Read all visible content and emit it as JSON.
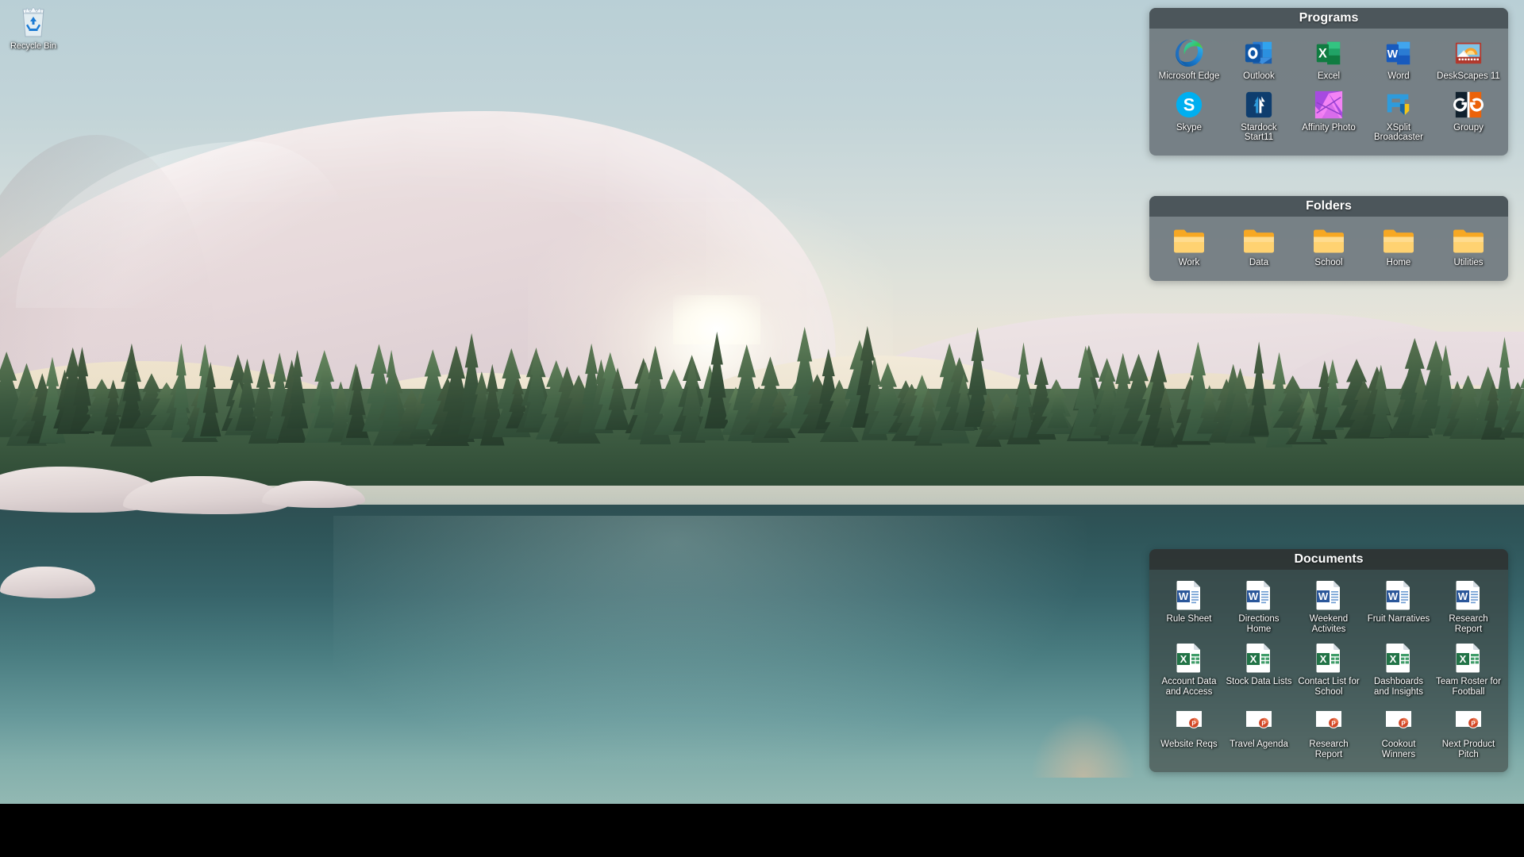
{
  "desktop": {
    "icons": [
      {
        "label": "Recycle Bin",
        "icon": "recycle-bin-icon"
      }
    ]
  },
  "fences": [
    {
      "id": "programs",
      "title": "Programs",
      "items": [
        {
          "label": "Microsoft Edge",
          "icon": "microsoft-edge-icon"
        },
        {
          "label": "Outlook",
          "icon": "outlook-icon"
        },
        {
          "label": "Excel",
          "icon": "excel-icon"
        },
        {
          "label": "Word",
          "icon": "word-icon"
        },
        {
          "label": "DeskScapes 11",
          "icon": "deskscapes-icon"
        },
        {
          "label": "Skype",
          "icon": "skype-icon"
        },
        {
          "label": "Stardock Start11",
          "icon": "start11-icon"
        },
        {
          "label": "Affinity Photo",
          "icon": "affinity-photo-icon"
        },
        {
          "label": "XSplit Broadcaster",
          "icon": "xsplit-broadcaster-icon"
        },
        {
          "label": "Groupy",
          "icon": "groupy-icon"
        }
      ]
    },
    {
      "id": "folders",
      "title": "Folders",
      "items": [
        {
          "label": "Work",
          "icon": "folder-icon"
        },
        {
          "label": "Data",
          "icon": "folder-icon"
        },
        {
          "label": "School",
          "icon": "folder-icon"
        },
        {
          "label": "Home",
          "icon": "folder-icon"
        },
        {
          "label": "Utilities",
          "icon": "folder-icon"
        }
      ]
    },
    {
      "id": "documents",
      "title": "Documents",
      "items": [
        {
          "label": "Rule Sheet",
          "icon": "word-doc-icon"
        },
        {
          "label": "Directions Home",
          "icon": "word-doc-icon"
        },
        {
          "label": "Weekend Activites",
          "icon": "word-doc-icon"
        },
        {
          "label": "Fruit Narratives",
          "icon": "word-doc-icon"
        },
        {
          "label": "Research Report",
          "icon": "word-doc-icon"
        },
        {
          "label": "Account Data and Access",
          "icon": "excel-doc-icon"
        },
        {
          "label": "Stock Data Lists",
          "icon": "excel-doc-icon"
        },
        {
          "label": "Contact List for School",
          "icon": "excel-doc-icon"
        },
        {
          "label": "Dashboards and Insights",
          "icon": "excel-doc-icon"
        },
        {
          "label": "Team Roster for Football",
          "icon": "excel-doc-icon"
        },
        {
          "label": "Website Reqs",
          "icon": "powerpoint-doc-icon"
        },
        {
          "label": "Travel Agenda",
          "icon": "powerpoint-doc-icon"
        },
        {
          "label": "Research Report",
          "icon": "powerpoint-doc-icon"
        },
        {
          "label": "Cookout Winners",
          "icon": "powerpoint-doc-icon"
        },
        {
          "label": "Next Product Pitch",
          "icon": "powerpoint-doc-icon"
        }
      ]
    }
  ],
  "colors": {
    "fence_header_opaque": "#4a5359",
    "fence_body_opaque": "#707a7f",
    "fence_header_glass": "#2a2c2a",
    "fence_body_glass": "#3c403e",
    "label_text": "#ffffff",
    "word_blue": "#2b579a",
    "excel_green": "#217346",
    "powerpoint_orange": "#d24726",
    "folder_yellow": "#ffcb5b",
    "bottom_bar": "#000000"
  },
  "wallpaper": {
    "scene": "pastel mountain lake at sunrise with pine forest",
    "sky": "#b9cfd6",
    "mountain": "#ece0e0",
    "sand": "#ece2d0",
    "forest": "#3d5b41",
    "lake": "#4a7d81"
  }
}
